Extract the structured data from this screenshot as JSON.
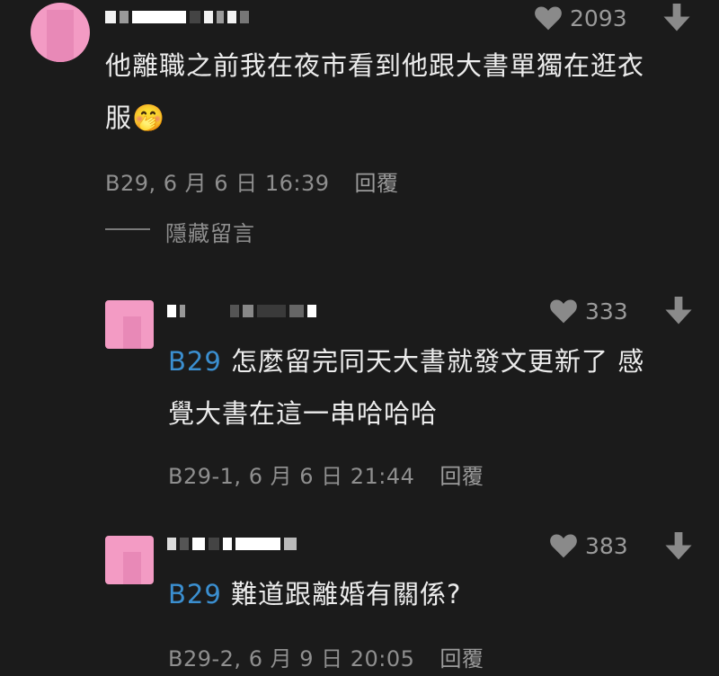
{
  "comments": [
    {
      "likes": "2093",
      "text_line1": "他離職之前我在夜市看到他跟大書單獨在逛衣",
      "text_line2": "服",
      "emoji": "🤭",
      "meta": "B29, 6 月 6 日 16:39",
      "reply_label": "回覆",
      "hide_label": "隱藏留言"
    }
  ],
  "replies": [
    {
      "likes": "333",
      "mention": "B29",
      "text_line1": " 怎麼留完同天大書就發文更新了 感",
      "text_line2": "覺大書在這一串哈哈哈",
      "meta": "B29-1, 6 月 6 日 21:44",
      "reply_label": "回覆"
    },
    {
      "likes": "383",
      "mention": "B29",
      "text_line1": " 難道跟離婚有關係?",
      "meta": "B29-2, 6 月 9 日 20:05",
      "reply_label": "回覆"
    }
  ],
  "colors": {
    "background": "#1b1b1b",
    "mention": "#3b8fd0",
    "avatar": "#f39bc4"
  },
  "icons": {
    "like": "heart-icon",
    "dislike": "down-arrow-icon"
  }
}
